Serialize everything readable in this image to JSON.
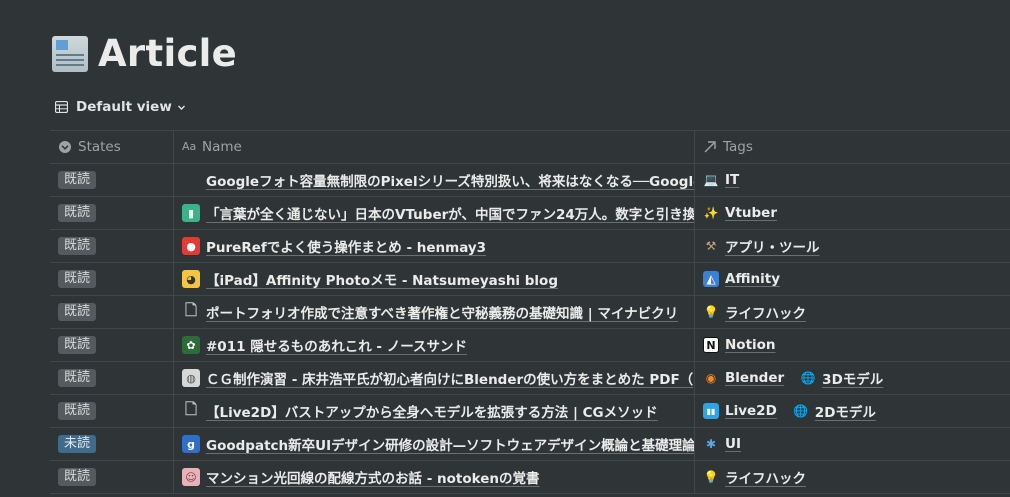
{
  "page": {
    "title": "Article",
    "icon": "newspaper-icon"
  },
  "view": {
    "label": "Default view",
    "icon": "table-icon"
  },
  "columns": {
    "states": "States",
    "name": "Name",
    "tags": "Tags"
  },
  "rows": [
    {
      "state": "既読",
      "title": "Googleフォト容量無制限のPixelシリーズ特別扱い、将来はなくなる──Google",
      "favicon": "blank-icon",
      "tags": [
        {
          "label": "IT",
          "icon": "laptop-icon"
        }
      ]
    },
    {
      "state": "既読",
      "title": "「言葉が全く通じない」日本のVTuberが、中国でファン24万人。数字と引き換",
      "favicon": "green-logo-icon",
      "tags": [
        {
          "label": "Vtuber",
          "icon": "sparkles-icon"
        }
      ]
    },
    {
      "state": "既読",
      "title": "PureRefでよく使う操作まとめ - henmay3",
      "favicon": "red-circle-icon",
      "tags": [
        {
          "label": "アプリ・ツール",
          "icon": "tools-icon"
        }
      ]
    },
    {
      "state": "既読",
      "title": "【iPad】Affinity Photoメモ - Natsumeyashi blog",
      "favicon": "cat-icon",
      "tags": [
        {
          "label": "Affinity",
          "icon": "affinity-icon"
        }
      ]
    },
    {
      "state": "既読",
      "title": "ポートフォリオ作成で注意すべき著作権と守秘義務の基礎知識 | マイナビクリ",
      "favicon": "document-icon",
      "tags": [
        {
          "label": "ライフハック",
          "icon": "lightbulb-icon"
        }
      ]
    },
    {
      "state": "既読",
      "title": "#011 隠せるものあれこれ - ノースサンド",
      "favicon": "leaf-icon",
      "tags": [
        {
          "label": "Notion",
          "icon": "notion-icon"
        }
      ]
    },
    {
      "state": "既読",
      "title": "ＣＧ制作演習 - 床井浩平氏が初心者向けにBlenderの使い方をまとめた PDF（",
      "favicon": "badge-icon",
      "tags": [
        {
          "label": "Blender",
          "icon": "blender-icon"
        },
        {
          "label": "3Dモデル",
          "icon": "globe-icon"
        }
      ]
    },
    {
      "state": "既読",
      "title": "【Live2D】バストアップから全身へモデルを拡張する方法 | CGメソッド",
      "favicon": "document-icon",
      "tags": [
        {
          "label": "Live2D",
          "icon": "live2d-icon"
        },
        {
          "label": "2Dモデル",
          "icon": "globe-icon"
        }
      ]
    },
    {
      "state": "未読",
      "title": "Goodpatch新卒UIデザイン研修の設計—ソフトウェアデザイン概論と基礎理論",
      "favicon": "goodpatch-icon",
      "tags": [
        {
          "label": "UI",
          "icon": "puzzle-icon"
        }
      ]
    },
    {
      "state": "既読",
      "title": "マンション光回線の配線方式のお話 - notokenの覚書",
      "favicon": "avatar-icon",
      "tags": [
        {
          "label": "ライフハック",
          "icon": "lightbulb-icon"
        }
      ]
    }
  ],
  "colors": {
    "background": "#2f3437",
    "unread_badge": "#3f6b8c",
    "read_badge": "#555a5e",
    "border": "#42474a"
  }
}
